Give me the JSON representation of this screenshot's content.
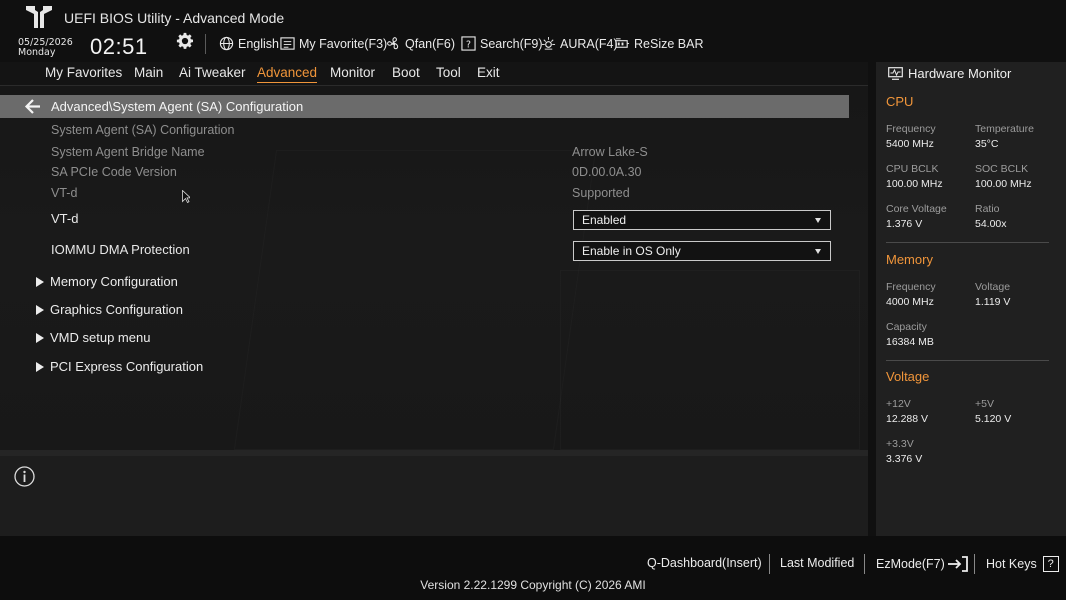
{
  "header": {
    "title": "UEFI BIOS Utility - Advanced Mode",
    "date": "05/25/2026",
    "day": "Monday",
    "time": "02:51",
    "tools": {
      "language": "English",
      "favorite": "My Favorite(F3)",
      "qfan": "Qfan(F6)",
      "search": "Search(F9)",
      "aura": "AURA(F4)",
      "resize_bar": "ReSize BAR"
    }
  },
  "nav": {
    "tabs": [
      "My Favorites",
      "Main",
      "Ai Tweaker",
      "Advanced",
      "Monitor",
      "Boot",
      "Tool",
      "Exit"
    ],
    "active": "Advanced"
  },
  "breadcrumb": "Advanced\\System Agent (SA) Configuration",
  "content": {
    "section_title": "System Agent (SA) Configuration",
    "rows": [
      {
        "label": "System Agent Bridge Name",
        "value": "Arrow Lake-S"
      },
      {
        "label": "SA PCIe Code Version",
        "value": "0D.00.0A.30"
      },
      {
        "label": "VT-d",
        "value": "Supported"
      }
    ],
    "settings": [
      {
        "label": "VT-d",
        "value": "Enabled"
      },
      {
        "label": "IOMMU DMA Protection",
        "value": "Enable in OS Only"
      }
    ],
    "submenus": [
      "Memory Configuration",
      "Graphics Configuration",
      "VMD setup menu",
      "PCI Express Configuration"
    ]
  },
  "hardware_monitor": {
    "title": "Hardware Monitor",
    "cpu": {
      "heading": "CPU",
      "frequency_label": "Frequency",
      "frequency": "5400 MHz",
      "temperature_label": "Temperature",
      "temperature": "35°C",
      "cpu_bclk_label": "CPU BCLK",
      "cpu_bclk": "100.00 MHz",
      "soc_bclk_label": "SOC BCLK",
      "soc_bclk": "100.00 MHz",
      "core_voltage_label": "Core Voltage",
      "core_voltage": "1.376 V",
      "ratio_label": "Ratio",
      "ratio": "54.00x"
    },
    "memory": {
      "heading": "Memory",
      "frequency_label": "Frequency",
      "frequency": "4000 MHz",
      "voltage_label": "Voltage",
      "voltage": "1.119 V",
      "capacity_label": "Capacity",
      "capacity": "16384 MB"
    },
    "voltage": {
      "heading": "Voltage",
      "v12_label": "+12V",
      "v12": "12.288 V",
      "v5_label": "+5V",
      "v5": "5.120 V",
      "v33_label": "+3.3V",
      "v33": "3.376 V"
    }
  },
  "footer": {
    "q_dashboard": "Q-Dashboard(Insert)",
    "last_modified": "Last Modified",
    "ezmode": "EzMode(F7)",
    "hot_keys": "Hot Keys",
    "hot_keys_icon": "?",
    "version": "Version 2.22.1299 Copyright (C) 2026 AMI"
  },
  "colors": {
    "accent": "#f0953a",
    "breadcrumb_bg": "#6b6b6b",
    "panel_bg": "#202020"
  }
}
